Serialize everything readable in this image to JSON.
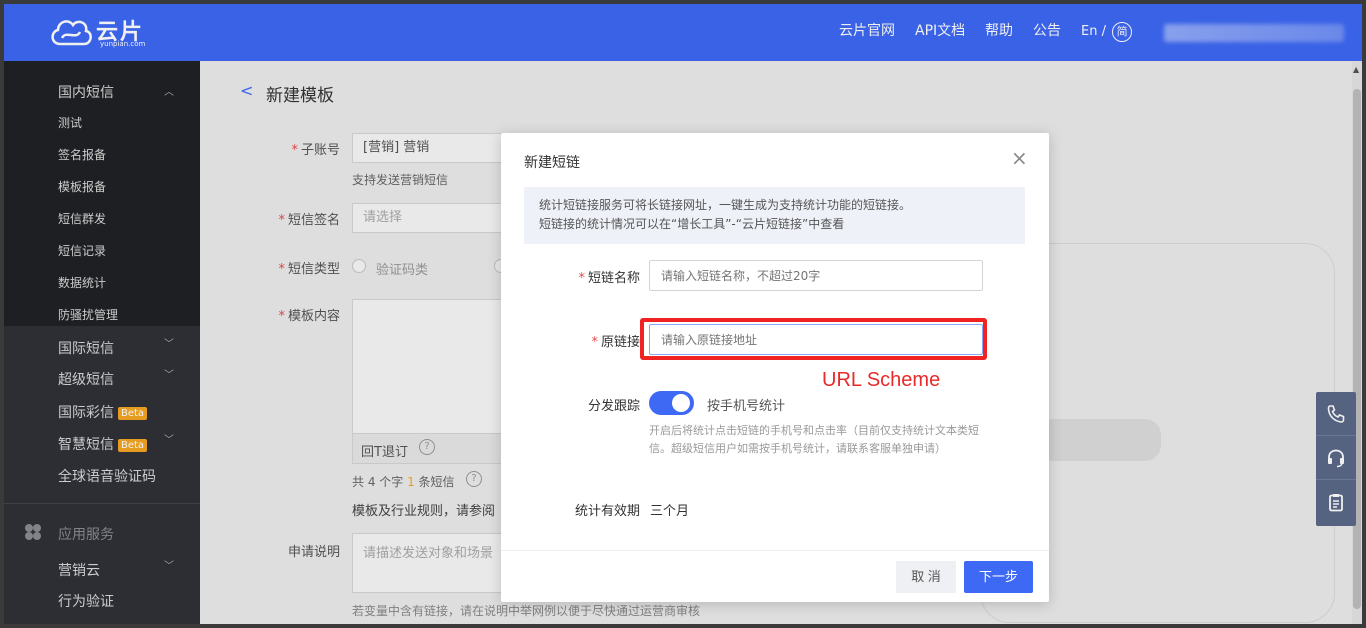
{
  "header": {
    "logo_text": "云片",
    "logo_sub": "yunpian.com",
    "nav": [
      "云片官网",
      "API文档",
      "帮助",
      "公告"
    ],
    "lang_prefix": "En /",
    "lang_simplified": "简"
  },
  "sidebar": {
    "domestic_sms": "国内短信",
    "domestic_items": [
      "测试",
      "签名报备",
      "模板报备",
      "短信群发",
      "短信记录",
      "数据统计",
      "防骚扰管理"
    ],
    "intl_sms": "国际短信",
    "super_sms": "超级短信",
    "intl_mms": "国际彩信",
    "smart_sms": "智慧短信",
    "beta": "Beta",
    "global_voice": "全球语音验证码",
    "app_services": "应用服务",
    "marketing_cloud": "营销云",
    "behavior_verify": "行为验证"
  },
  "page": {
    "back": "<",
    "title": "新建模板",
    "subaccount_label": "子账号",
    "subaccount_value": "[营销] 营销",
    "subaccount_hint": "支持发送营销短信",
    "signature_label": "短信签名",
    "signature_placeholder": "请选择",
    "type_label": "短信类型",
    "type_option1": "验证码类",
    "content_label": "模板内容",
    "unsubscribe": "回T退订",
    "count_prefix": "共 4 个字 ",
    "count_num": "1",
    "count_suffix": " 条短信",
    "rules_text": "模板及行业规则，请参阅",
    "apply_label": "申请说明",
    "apply_placeholder": "请描述发送对象和场景",
    "apply_hint": "若变量中含有链接，请在说明中举网例以便于尽快通过运营商审核"
  },
  "modal": {
    "title": "新建短链",
    "close": "×",
    "info_line1": "统计短链接服务可将长链接网址，一键生成为支持统计功能的短链接。",
    "info_line2": "短链接的统计情况可以在“增长工具”-“云片短链接”中查看",
    "name_label": "短链名称",
    "name_placeholder": "请输入短链名称，不超过20字",
    "url_label": "原链接",
    "url_placeholder": "请输入原链接地址",
    "annotation": "URL Scheme",
    "track_label": "分发跟踪",
    "track_text": "按手机号统计",
    "track_enabled": true,
    "track_help": "开启后将统计点击短链的手机号和点击率（目前仅支持统计文本类短信。超级短信用户如需按手机号统计，请联系客服单独申请）",
    "validity_label": "统计有效期",
    "validity_value": "三个月",
    "cancel": "取 消",
    "next": "下一步",
    "required_mark": "*"
  },
  "colors": {
    "brand": "#3d69f5",
    "highlight": "#f02222",
    "sidebar": "#2f3137"
  }
}
